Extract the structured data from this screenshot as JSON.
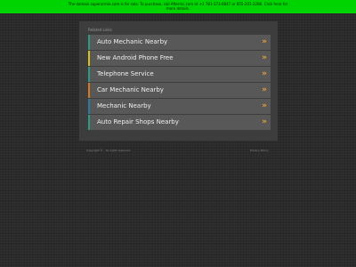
{
  "banner": {
    "line1": "The domain superarmie.com is for sale. To purchase, call Afternic.com at +1 781-373-6847 or 855-201-2286. Click here for",
    "line2": "more details."
  },
  "panel": {
    "title": "Related Links",
    "links": [
      {
        "label": "Auto Mechanic Nearby",
        "accent": "#2e9a85"
      },
      {
        "label": "New Android Phone Free",
        "accent": "#d6c21f"
      },
      {
        "label": "Telephone Service",
        "accent": "#2e9a85"
      },
      {
        "label": "Car Mechanic Nearby",
        "accent": "#d67a1f"
      },
      {
        "label": "Mechanic Nearby",
        "accent": "#2e7a9a"
      },
      {
        "label": "Auto Repair Shops Nearby",
        "accent": "#2e9a85"
      }
    ],
    "chevron_icon": "double-chevron-right",
    "chevron_glyph": "»",
    "chevron_color": "#e8a237"
  },
  "footer": {
    "copyright": "Copyright © . All rights reserved.",
    "privacy": "Privacy Policy"
  },
  "colors": {
    "background": "#2b2b2b",
    "banner": "#00d400",
    "panel": "#3d3d3d",
    "row": "#585858"
  }
}
